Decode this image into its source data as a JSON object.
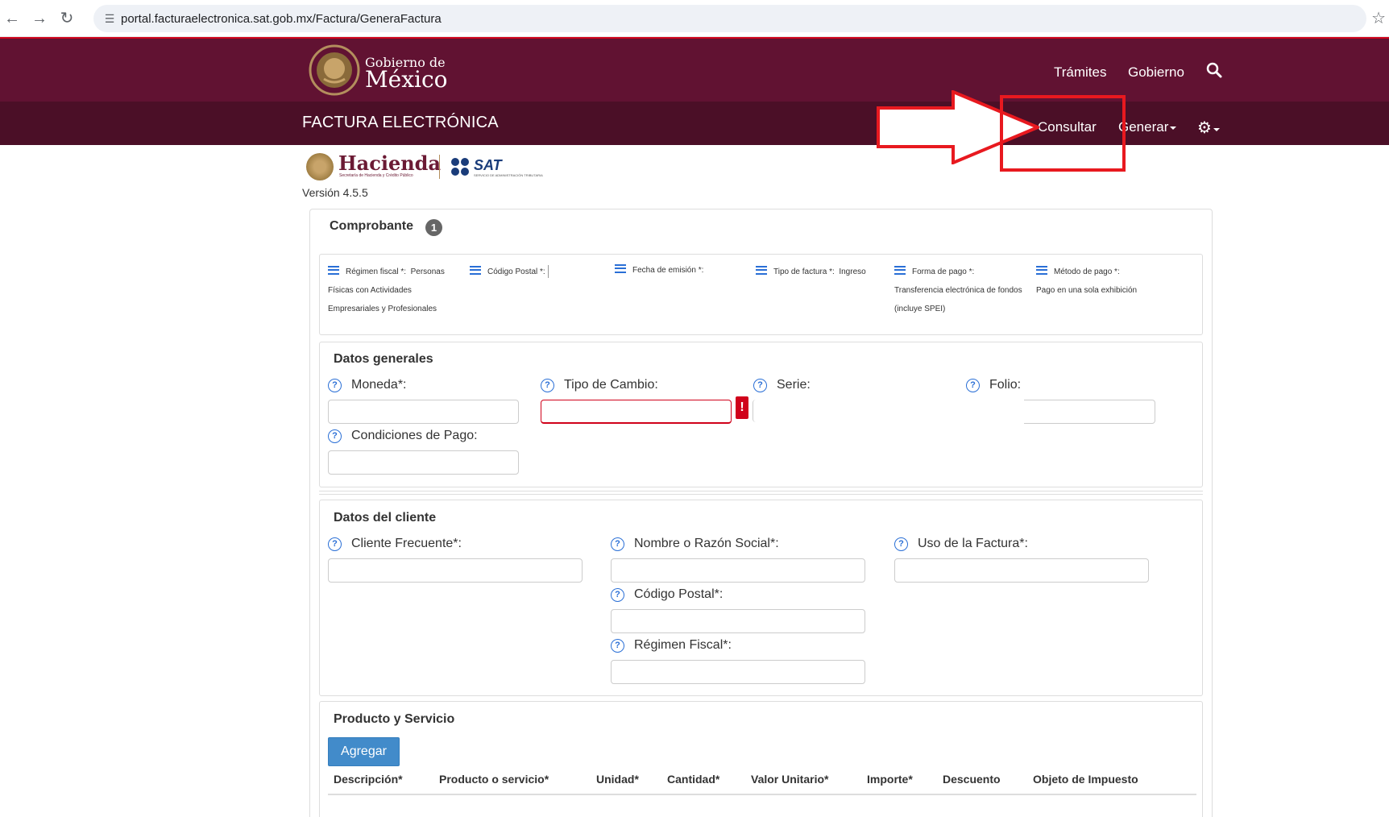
{
  "browser": {
    "url": "portal.facturaelectronica.sat.gob.mx/Factura/GeneraFactura",
    "back_icon": "arrow-left-icon",
    "forward_icon": "arrow-right-icon",
    "reload_icon": "reload-icon",
    "star_icon": "star-icon"
  },
  "gob_header": {
    "title_line1": "Gobierno de",
    "title_line2": "México",
    "nav": [
      "Trámites",
      "Gobierno"
    ],
    "colors": {
      "primary": "#611232",
      "secondary": "#4b0f27",
      "accent": "#d0021b"
    }
  },
  "fe_bar": {
    "title": "FACTURA ELECTRÓNICA",
    "consultar": "Consultar",
    "generar": "Generar"
  },
  "logos": {
    "hacienda": "Hacienda",
    "hacienda_sub": "Secretaría de Hacienda y Crédito Público",
    "sat": "SAT",
    "sat_sub": "SERVICIO DE ADMINISTRACIÓN TRIBUTARIA"
  },
  "version": "Versión 4.5.5",
  "comprobante": {
    "title": "Comprobante",
    "step": "1",
    "summary": {
      "regimen_label": "Régimen fiscal *:",
      "regimen_value_1": "Personas",
      "regimen_value_2": "Físicas con Actividades",
      "regimen_value_3": "Empresariales y Profesionales",
      "cp_label": "Código Postal *:",
      "fecha_label": "Fecha de emisión *:",
      "tipo_label": "Tipo de factura *:",
      "tipo_value": "Ingreso",
      "forma_label": "Forma de pago *:",
      "forma_value_1": "Transferencia electrónica de fondos",
      "forma_value_2": "(incluye SPEI)",
      "metodo_label": "Método de pago *:",
      "metodo_value": "Pago en una sola exhibición"
    }
  },
  "datos_generales": {
    "title": "Datos generales",
    "moneda": "Moneda*:",
    "tipo_cambio": "Tipo de Cambio:",
    "serie": "Serie:",
    "folio": "Folio:",
    "condiciones": "Condiciones de Pago:",
    "error_mark": "!"
  },
  "datos_cliente": {
    "title": "Datos del cliente",
    "cliente_frecuente": "Cliente Frecuente*:",
    "nombre": "Nombre o Razón Social*:",
    "uso": "Uso de la Factura*:",
    "codigo_postal": "Código Postal*:",
    "regimen": "Régimen Fiscal*:"
  },
  "producto": {
    "title": "Producto y Servicio",
    "agregar": "Agregar",
    "columns": [
      "Descripción*",
      "Producto o servicio*",
      "Unidad*",
      "Cantidad*",
      "Valor Unitario*",
      "Importe*",
      "Descuento",
      "Objeto de Impuesto"
    ]
  },
  "help_glyph": "?"
}
